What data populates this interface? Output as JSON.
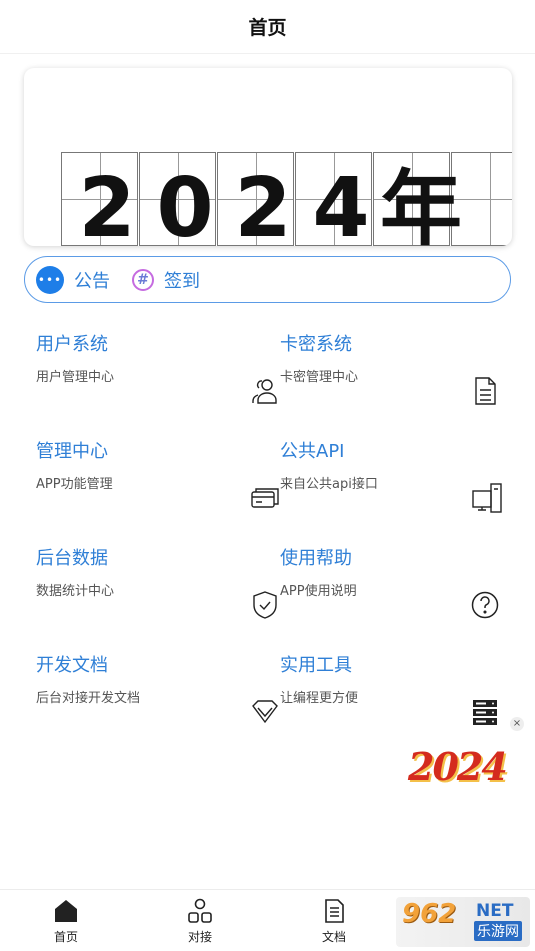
{
  "header": {
    "title": "首页"
  },
  "banner": {
    "year_chars": [
      "2",
      "0",
      "2",
      "4",
      "年"
    ]
  },
  "notice_bar": {
    "announcement_label": "公告",
    "announcement_icon": "chat-bubble-icon",
    "signin_label": "签到",
    "signin_icon": "hashtag-icon"
  },
  "menu": {
    "items": [
      {
        "title": "用户系统",
        "subtitle": "用户管理中心",
        "icon": "users-icon"
      },
      {
        "title": "卡密系统",
        "subtitle": "卡密管理中心",
        "icon": "document-icon"
      },
      {
        "title": "管理中心",
        "subtitle": "APP功能管理",
        "icon": "cards-icon"
      },
      {
        "title": "公共API",
        "subtitle": "来自公共api接口",
        "icon": "monitor-icon"
      },
      {
        "title": "后台数据",
        "subtitle": "数据统计中心",
        "icon": "shield-check-icon"
      },
      {
        "title": "使用帮助",
        "subtitle": "APP使用说明",
        "icon": "help-circle-icon"
      },
      {
        "title": "开发文档",
        "subtitle": "后台对接开发文档",
        "icon": "diamond-icon"
      },
      {
        "title": "实用工具",
        "subtitle": "让编程更方便",
        "icon": "server-icon"
      }
    ]
  },
  "promo": {
    "text": "2024",
    "close": "×"
  },
  "tabbar": {
    "tabs": [
      {
        "label": "首页",
        "icon": "home-icon"
      },
      {
        "label": "对接",
        "icon": "shapes-icon"
      },
      {
        "label": "文档",
        "icon": "file-text-icon"
      }
    ]
  },
  "watermark": {
    "brand_num": "962",
    "brand_net": "NET",
    "brand_cn": "乐游网"
  },
  "colors": {
    "accent": "#2f7fd6",
    "border": "#5b9be6",
    "notice_icon": "#1e7ee8"
  }
}
